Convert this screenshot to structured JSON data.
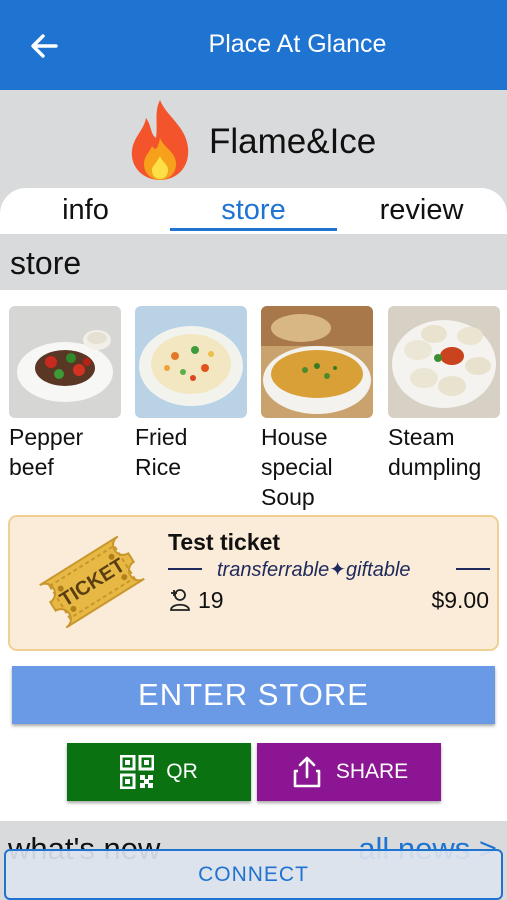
{
  "appbar": {
    "title": "Place At Glance",
    "back_icon": "arrow-left-icon"
  },
  "place": {
    "name": "Flame&Ice",
    "logo_icon": "flame-icon"
  },
  "tabs": [
    {
      "label": "info",
      "active": false
    },
    {
      "label": "store",
      "active": true
    },
    {
      "label": "review",
      "active": false
    }
  ],
  "section": {
    "label": "store"
  },
  "products": [
    {
      "name": "Pepper\nbeef"
    },
    {
      "name": "Fried\nRice"
    },
    {
      "name": "House\nspecial\nSoup"
    },
    {
      "name": "Steam\ndumpling"
    }
  ],
  "ticket": {
    "title": "Test ticket",
    "tags": "transferrable✦giftable",
    "count": "19",
    "price": "$9.00",
    "image_text": "TICKET"
  },
  "buttons": {
    "enter_store": "ENTER STORE",
    "qr": "QR",
    "share": "SHARE"
  },
  "news": {
    "label": "what's new",
    "all_link": "all news >"
  },
  "connect": {
    "label": "CONNECT"
  },
  "colors": {
    "primary": "#1f73d1",
    "enter_button": "#6a9ae6",
    "qr_button": "#0b7212",
    "share_button": "#8b1592",
    "ticket_bg": "#fbebd9"
  }
}
